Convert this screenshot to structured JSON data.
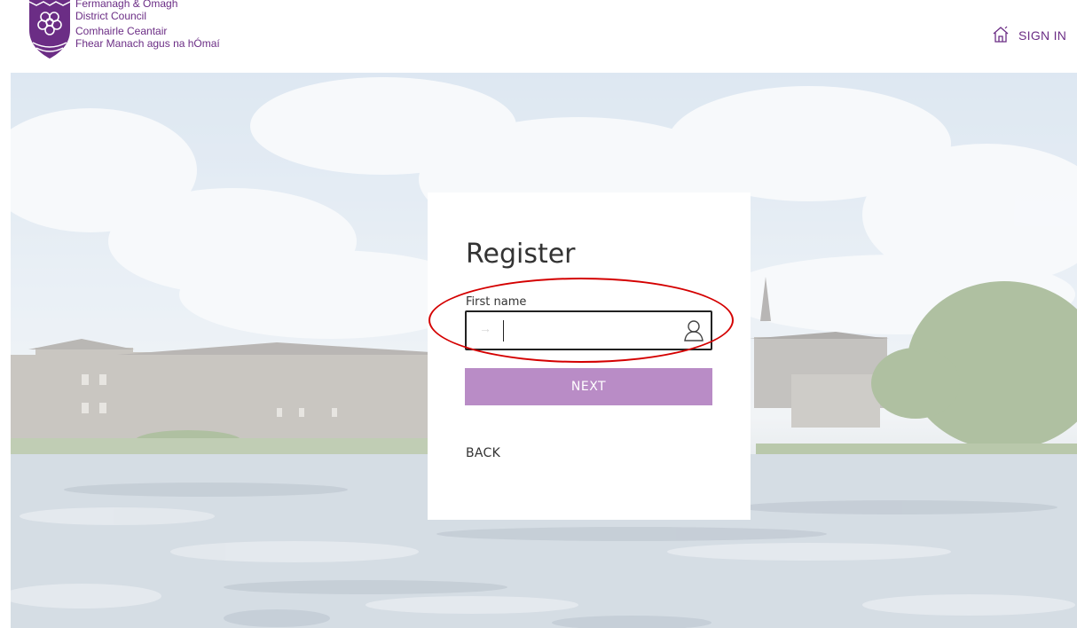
{
  "header": {
    "org_name_en_line1": "Fermanagh & Omagh",
    "org_name_en_line2": "District Council",
    "org_name_ga_line1": "Comhairle Ceantair",
    "org_name_ga_line2": "Fhear Manach agus na hÓmaí",
    "home_icon": "home-icon",
    "sign_in_label": "SIGN IN"
  },
  "register": {
    "title": "Register",
    "first_name_label": "First name",
    "first_name_value": "",
    "first_name_placeholder": "",
    "field_prefix_icon": "arrow-right-icon",
    "field_suffix_icon": "user-icon",
    "next_label": "NEXT",
    "back_label": "BACK"
  },
  "colors": {
    "brand": "#6b2d85",
    "next_button": "#b98cc6",
    "highlight": "#d40000"
  }
}
